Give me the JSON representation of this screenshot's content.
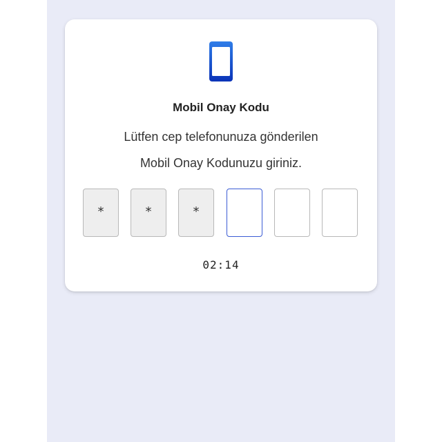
{
  "card": {
    "icon": "mobile-phone-icon",
    "title": "Mobil Onay Kodu",
    "description_line1": "Lütfen cep telefonunuza gönderilen",
    "description_line2": "Mobil Onay Kodunuzu giriniz.",
    "otp": {
      "digits": [
        "*",
        "*",
        "*",
        "",
        "",
        ""
      ],
      "active_index": 3
    },
    "timer": "02:14"
  },
  "colors": {
    "background": "#e9ebf7",
    "icon_gradient_top": "#2f7de8",
    "icon_gradient_bottom": "#0a33b8",
    "active_border": "#3a5bd4"
  }
}
